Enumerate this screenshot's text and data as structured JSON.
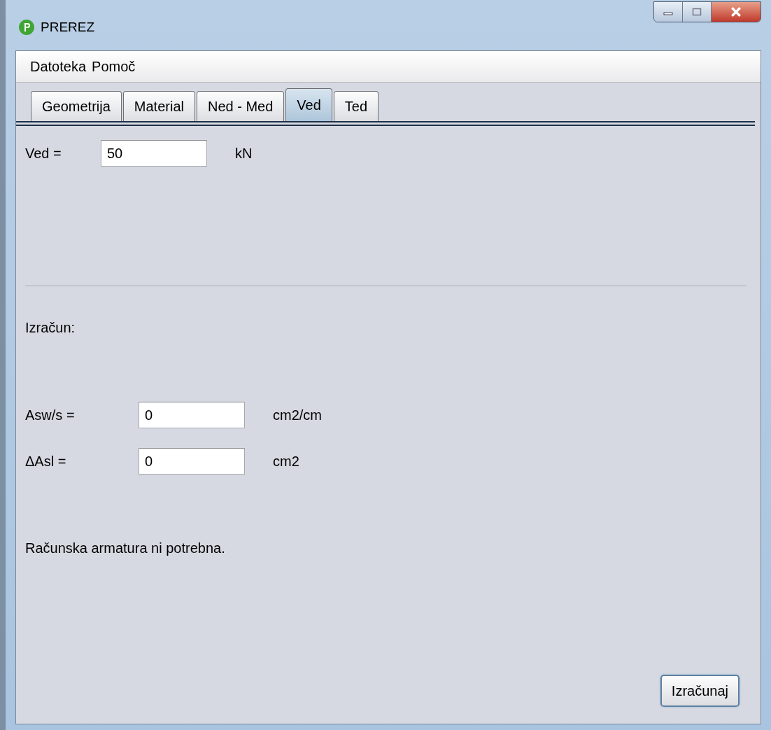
{
  "window": {
    "title": "PREREZ"
  },
  "menu": [
    "Datoteka",
    "Pomoč"
  ],
  "tabs": [
    {
      "label": "Geometrija",
      "selected": false
    },
    {
      "label": "Material",
      "selected": false
    },
    {
      "label": "Ned - Med",
      "selected": false
    },
    {
      "label": "Ved",
      "selected": true
    },
    {
      "label": "Ted",
      "selected": false
    }
  ],
  "input": {
    "label": "Ved =",
    "value": "50",
    "unit": "kN"
  },
  "section_title": "Izračun:",
  "results": [
    {
      "label": "Asw/s =",
      "value": "0",
      "unit": "cm2/cm"
    },
    {
      "label": "ΔAsl =",
      "value": "0",
      "unit": "cm2"
    }
  ],
  "message": "Računska armatura ni potrebna.",
  "button": "Izračunaj"
}
